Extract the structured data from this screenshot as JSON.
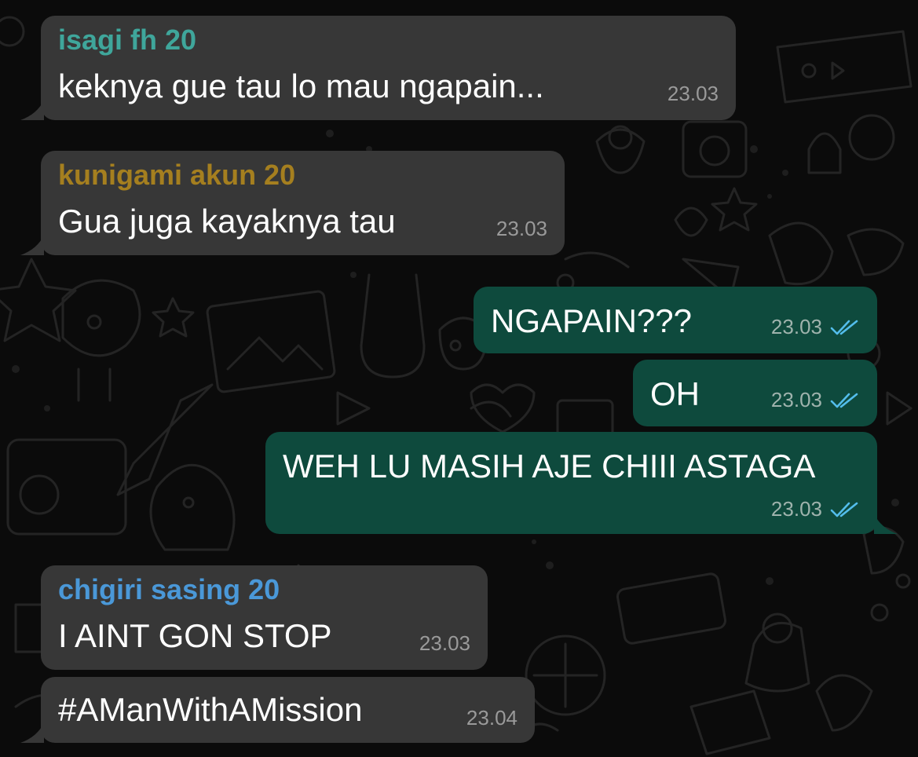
{
  "colors": {
    "incoming_bubble": "#373737",
    "outgoing_bubble": "#0e4a3d",
    "sender_isagi": "#3fa69b",
    "sender_kunigami": "#a57f1f",
    "sender_chigiri": "#4a98d8",
    "read_ticks": "#53bdeb"
  },
  "messages": [
    {
      "direction": "incoming",
      "sender": "isagi fh 20",
      "text": "keknya gue tau lo mau ngapain...",
      "time": "23.03"
    },
    {
      "direction": "incoming",
      "sender": "kunigami akun 20",
      "text": "Gua juga kayaknya tau",
      "time": "23.03"
    },
    {
      "direction": "outgoing",
      "text": "NGAPAIN???",
      "time": "23.03",
      "status_icon": "double-check-read-icon"
    },
    {
      "direction": "outgoing",
      "text": "OH",
      "time": "23.03",
      "status_icon": "double-check-read-icon"
    },
    {
      "direction": "outgoing",
      "text": "WEH LU MASIH AJE CHIII ASTAGA",
      "time": "23.03",
      "status_icon": "double-check-read-icon"
    },
    {
      "direction": "incoming",
      "sender": "chigiri sasing 20",
      "text": "I AINT GON STOP",
      "time": "23.03"
    },
    {
      "direction": "incoming",
      "text": "#AManWithAMission",
      "time": "23.04"
    }
  ]
}
